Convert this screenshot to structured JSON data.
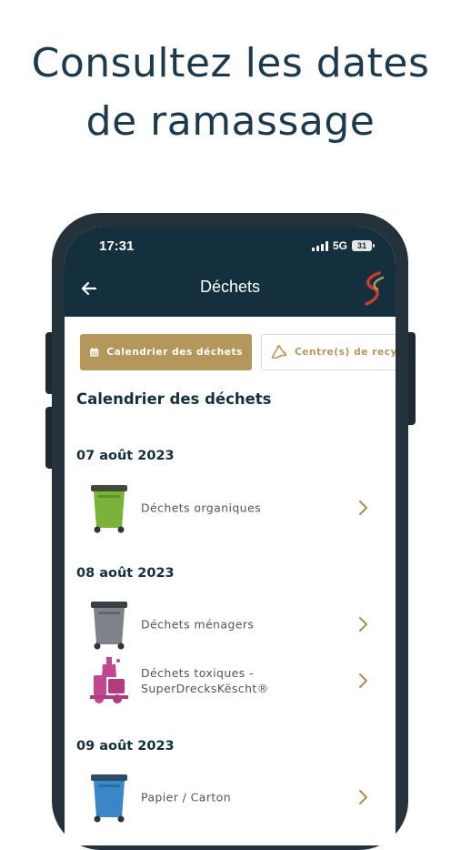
{
  "headline": {
    "line1": "Consultez les dates",
    "line2": "de ramassage"
  },
  "status_bar": {
    "time": "17:31",
    "network": "5G",
    "battery": "31"
  },
  "nav": {
    "title": "Déchets",
    "back_icon": "arrow-left-icon",
    "logo_icon": "app-logo-icon"
  },
  "tabs": [
    {
      "label": "Calendrier des déchets",
      "icon": "calendar-icon",
      "active": true
    },
    {
      "label": "Centre(s) de recyc",
      "icon": "recycle-icon",
      "active": false
    }
  ],
  "section_title": "Calendrier des déchets",
  "schedule": [
    {
      "date": "07 août 2023",
      "items": [
        {
          "label": "Déchets organiques",
          "icon": "green-bin-icon"
        }
      ]
    },
    {
      "date": "08 août 2023",
      "items": [
        {
          "label": "Déchets ménagers",
          "icon": "grey-bin-icon"
        },
        {
          "label": "Déchets toxiques - SuperDrecksKëscht®",
          "icon": "toxic-waste-icon"
        }
      ]
    },
    {
      "date": "09 août 2023",
      "items": [
        {
          "label": "Papier / Carton",
          "icon": "blue-bin-icon"
        }
      ]
    }
  ],
  "colors": {
    "navy": "#14303f",
    "gold": "#b4975a",
    "organic": "#7ab338",
    "household": "#7d8388",
    "toxic": "#c2478f",
    "paper": "#3b86c6"
  }
}
